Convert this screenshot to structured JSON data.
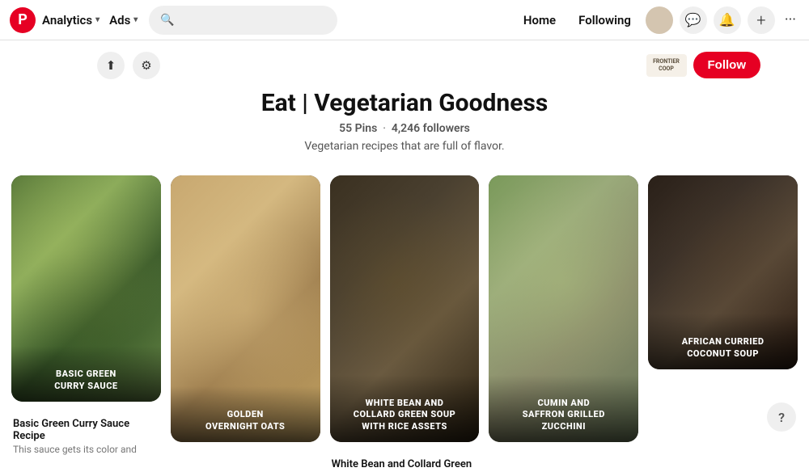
{
  "nav": {
    "analytics_label": "Analytics",
    "ads_label": "Ads",
    "search_placeholder": "",
    "home_label": "Home",
    "following_label": "Following"
  },
  "board": {
    "title": "Eat | Vegetarian Goodness",
    "pins_count": "55 Pins",
    "followers_count": "4,246 followers",
    "description": "Vegetarian recipes that are full of flavor.",
    "follow_label": "Follow",
    "frontier_name": "FRONTIER"
  },
  "pins": [
    {
      "id": "col1",
      "cards": [
        {
          "label": "BASIC GREEN\nCURRY SAUCE",
          "style": "food-green",
          "height": "img-tall",
          "caption_title": "Basic Green Curry Sauce Recipe",
          "caption_sub": "This sauce gets its color and"
        }
      ]
    },
    {
      "id": "col2",
      "cards": [
        {
          "label": "GOLDEN\nOVERNIGHT OATS",
          "style": "food-oats",
          "height": "img-full",
          "caption_title": "",
          "caption_sub": ""
        }
      ]
    },
    {
      "id": "col3",
      "cards": [
        {
          "label": "WHITE BEAN AND\nCOLLARD GREEN SOUP\nWITH RICE ASSETS",
          "style": "food-soup",
          "height": "img-full",
          "caption_title": "White Bean and Collard Green",
          "caption_sub": ""
        }
      ]
    },
    {
      "id": "col4",
      "cards": [
        {
          "label": "CUMIN AND\nSAFFRON GRILLED\nZUCCHINI",
          "style": "food-zucchini",
          "height": "img-full",
          "caption_title": "",
          "caption_sub": ""
        }
      ]
    },
    {
      "id": "col5",
      "cards": [
        {
          "label": "AFRICAN CURRIED\nCOCONUT SOUP",
          "style": "food-coconut",
          "height": "img-medium",
          "caption_title": "",
          "caption_sub": ""
        }
      ]
    }
  ],
  "icons": {
    "pinterest": "P",
    "chevron": "▾",
    "search": "🔍",
    "chat": "💬",
    "bell": "🔔",
    "plus": "+",
    "more": "···",
    "upload": "⬆",
    "settings": "⚙",
    "help": "?"
  }
}
